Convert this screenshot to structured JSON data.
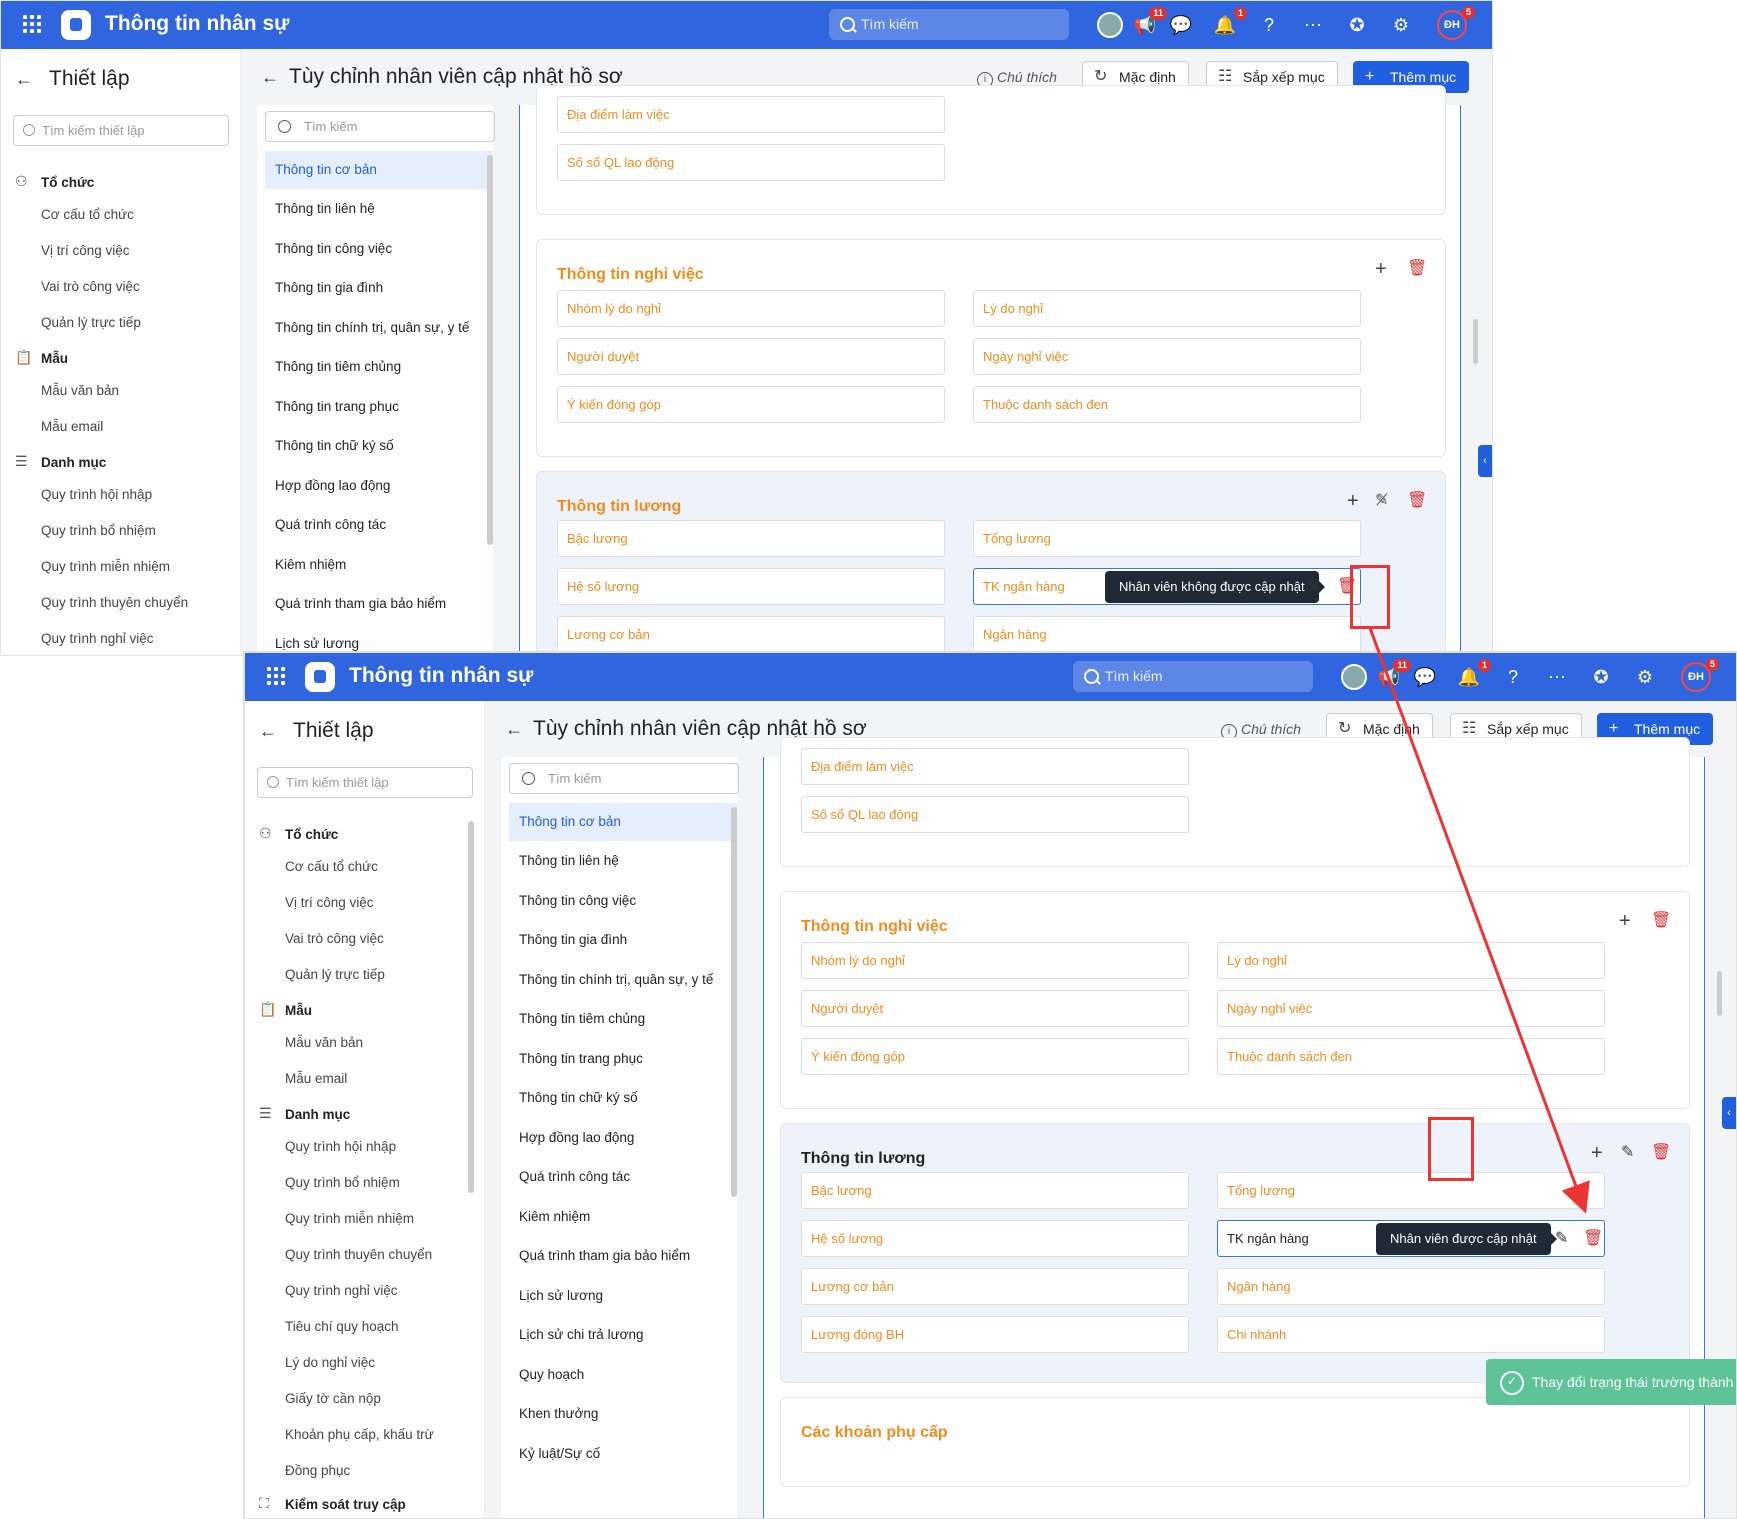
{
  "app": {
    "title": "Thông tin nhân sự",
    "search_placeholder": "Tìm kiếm",
    "notif_badge_1": "11",
    "notif_badge_2": "1",
    "user_initials": "ĐH",
    "user_badge": "5"
  },
  "sidebar": {
    "back": "←",
    "title": "Thiết lập",
    "search_placeholder": "Tìm kiếm thiết lập",
    "group_org": "Tổ chức",
    "org_items": [
      "Cơ cấu tổ chức",
      "Vị trí công việc",
      "Vai trò công việc",
      "Quản lý trực tiếp"
    ],
    "group_template": "Mẫu",
    "template_items": [
      "Mẫu văn bản",
      "Mẫu email"
    ],
    "group_catalog": "Danh mục",
    "catalog_items": [
      "Quy trình hội nhập",
      "Quy trình bổ nhiệm",
      "Quy trình miễn nhiệm",
      "Quy trình thuyên chuyển",
      "Quy trình nghỉ việc",
      "Tiêu chí quy hoạch",
      "Lý do nghỉ việc",
      "Giấy tờ cần nộp",
      "Khoản phụ cấp, khấu trừ",
      "Đồng phục"
    ],
    "group_access": "Kiểm soát truy cập"
  },
  "header": {
    "back": "←",
    "title": "Tùy chỉnh nhân viên cập nhật hồ sơ",
    "note": "Chú thích",
    "default_btn": "Mặc định",
    "sort_btn": "Sắp xếp mục",
    "add_btn": "Thêm mục"
  },
  "categories": {
    "search_placeholder": "Tìm kiếm",
    "items": [
      "Thông tin cơ bản",
      "Thông tin liên hệ",
      "Thông tin công việc",
      "Thông tin gia đình",
      "Thông tin chính trị, quân sự, y tế",
      "Thông tin tiêm chủng",
      "Thông tin trang phục",
      "Thông tin chữ ký số",
      "Hợp đồng lao động",
      "Quá trình công tác",
      "Kiêm nhiệm",
      "Quá trình tham gia bảo hiểm",
      "Lịch sử lương",
      "Lịch sử chi trả lương",
      "Quy hoạch",
      "Khen thưởng",
      "Kỷ luật/Sự cố"
    ]
  },
  "cards": {
    "top_fields": [
      "Địa điểm làm việc",
      "Số sổ QL lao động"
    ],
    "resign_title": "Thông tin nghỉ việc",
    "resign_fields": [
      "Nhóm lý do nghỉ",
      "Lý do nghỉ",
      "Người duyệt",
      "Ngày nghỉ việc",
      "Ý kiến đóng góp",
      "Thuộc danh sách đen"
    ],
    "salary_title": "Thông tin lương",
    "salary_fields": [
      "Bậc lương",
      "Tổng lương",
      "Hệ số lương",
      "TK ngân hàng",
      "Lương cơ bản",
      "Ngân hàng",
      "Lương đóng BH",
      "Chi nhánh"
    ],
    "allowance_title": "Các khoản phụ cấp"
  },
  "tooltips": {
    "not_allowed": "Nhân viên không được cập nhật",
    "allowed": "Nhân viên được cập nhật"
  },
  "toast": {
    "message": "Thay đổi trạng thái trường thành công"
  },
  "icons": {
    "grid": "grid-icon",
    "logo": "app-logo-icon",
    "search": "search-icon",
    "megaphone": "megaphone-icon",
    "chat": "chat-icon",
    "bell": "bell-icon",
    "help": "help-icon",
    "more": "more-icon",
    "award": "award-icon",
    "gear": "gear-icon",
    "plus": "plus-icon",
    "trash": "trash-icon",
    "pen": "pen-icon",
    "pen_off": "pen-off-icon"
  },
  "colors": {
    "topbar": "#2f66df",
    "accent": "#1f5fe0",
    "orange_label": "#f08c1d",
    "danger": "#e03232",
    "toast": "#5ec497",
    "highlight": "#e33"
  }
}
